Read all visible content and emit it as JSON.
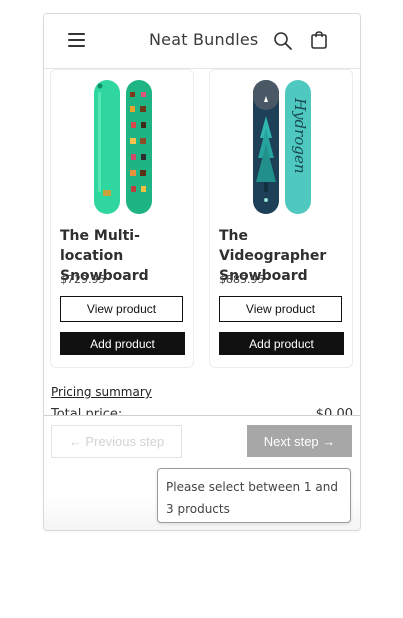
{
  "header": {
    "title": "Neat Bundles",
    "menu_icon": "hamburger-menu-icon",
    "search_icon": "search-icon",
    "cart_icon": "cart-icon"
  },
  "products": [
    {
      "name": "The Multi-location Snowboard",
      "price": "$729.95",
      "view_label": "View product",
      "add_label": "Add product",
      "board_colors": [
        "#2fd6a0",
        "#1fb484"
      ]
    },
    {
      "name": "The Videographer Snowboard",
      "price": "$885.95",
      "view_label": "View product",
      "add_label": "Add product",
      "board_colors": [
        "#1d3f57",
        "#4fc9c0"
      ],
      "board_text": "Hydrogen"
    }
  ],
  "summary": {
    "link_label": "Pricing summary",
    "total_label": "Total price:",
    "total_value": "$0.00"
  },
  "footer": {
    "prev_label": "← Previous step",
    "next_label": "Next step →",
    "tooltip": "Please select between 1 and 3 products"
  },
  "colors": {
    "add_button_bg": "#111111",
    "next_button_bg": "#a7a7a7",
    "accent_green": "#2fd6a0",
    "accent_navy": "#1d3f57"
  }
}
